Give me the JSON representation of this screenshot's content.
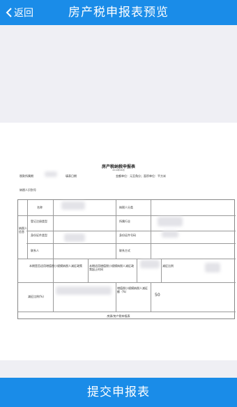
{
  "nav": {
    "back_label": "返回",
    "title": "房产税申报表预览"
  },
  "document": {
    "title": "房产税纳税申报表",
    "date": "2019年06月",
    "head_left": "税款所属期",
    "head_mid": "填表日期",
    "head_right": "金额单位：元至角分；面积单位：平方米",
    "taxpayer_label": "纳税人识别号",
    "taxpayer_info_label": "纳税人信息",
    "row1_name": "名称",
    "row1_right": "纳税人分类",
    "row2_left": "登记注册类型",
    "row2_right": "所属行业",
    "row3_left": "身份证件类型",
    "row3_right": "身份证件号码",
    "row4_left": "联系人",
    "row4_right": "联系方式",
    "row5_a": "本期是否适用增值税小规模纳税人减征政策",
    "row5_b": "本期适用增值税小规模纳税人减征政策起止时间",
    "row5_c": "减征比例",
    "row6_label": "减征比例(%)",
    "row6_mid": "增值税小规模纳税人减征额（%）",
    "row6_value": "50",
    "footer": "房源/房产税申报表"
  },
  "submit_label": "提交申报表"
}
